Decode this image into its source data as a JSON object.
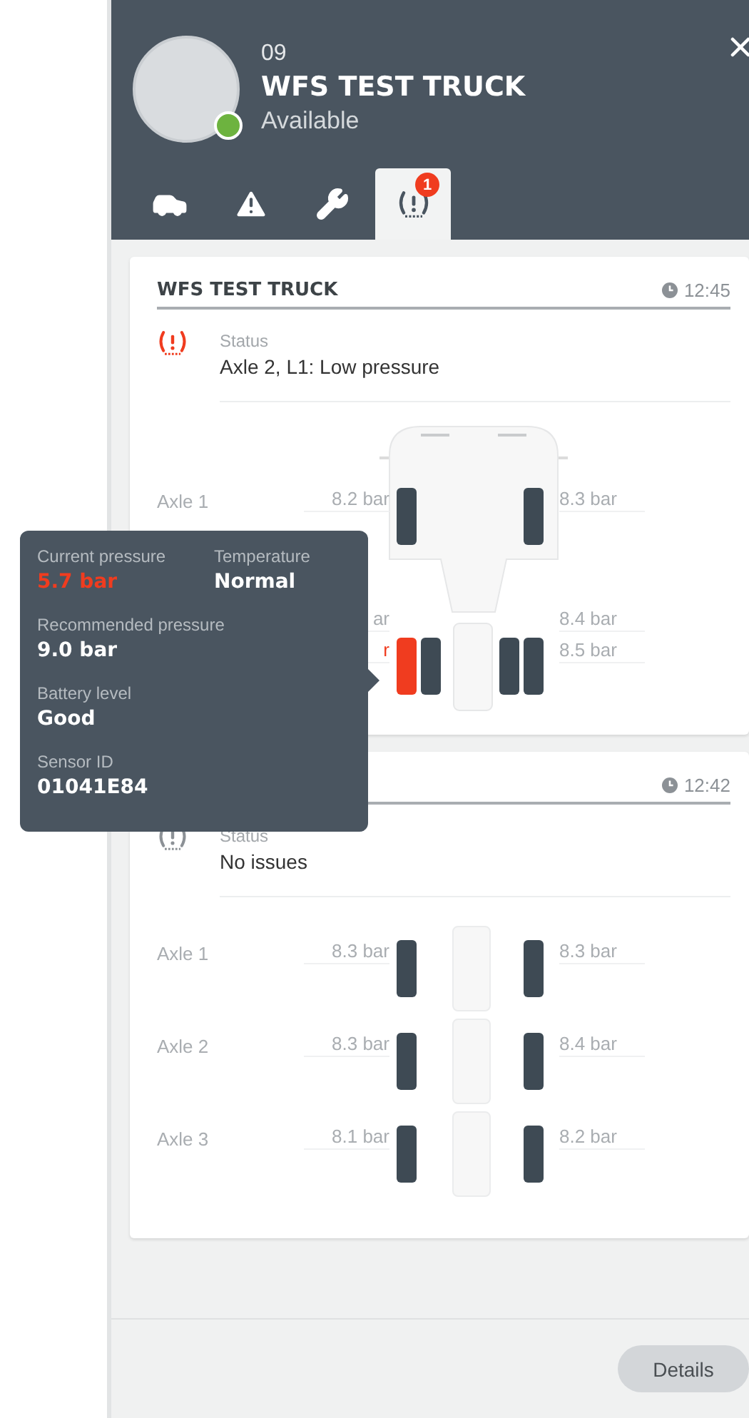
{
  "vehicle": {
    "number": "09",
    "name": "WFS TEST TRUCK",
    "status": "Available",
    "color": "#6db33f"
  },
  "tabs": [
    {
      "kind": "car",
      "selected": false
    },
    {
      "kind": "warning",
      "selected": false
    },
    {
      "kind": "wrench",
      "selected": false
    },
    {
      "kind": "tire",
      "selected": true,
      "badge": "1"
    }
  ],
  "cards": [
    {
      "title": "WFS TEST TRUCK",
      "time": "12:45",
      "status_label": "Status",
      "status": "Axle 2, L1: Low pressure",
      "alert": true,
      "kind": "outline",
      "axles": [
        {
          "label": "Axle 1",
          "left": {
            "readings": [
              {
                "text": "8.2 bar",
                "low": false
              }
            ],
            "tires": [
              {
                "low": false
              }
            ]
          },
          "right": {
            "readings": [
              {
                "text": "8.3 bar",
                "low": false
              }
            ],
            "tires": [
              {
                "low": false
              }
            ]
          }
        },
        {
          "left": {
            "readings": [
              {
                "text": "ar",
                "low": false
              },
              {
                "text": "r",
                "low": true
              }
            ],
            "tires": [
              {
                "low": true
              },
              {
                "low": false
              }
            ]
          },
          "right": {
            "readings": [
              {
                "text": "8.4 bar",
                "low": false
              },
              {
                "text": "8.5 bar",
                "low": false
              }
            ],
            "tires": [
              {
                "low": false
              },
              {
                "low": false
              }
            ]
          }
        }
      ]
    },
    {
      "time": "12:42",
      "status_label": "Status",
      "status": "No issues",
      "alert": false,
      "kind": "segments",
      "axles": [
        {
          "label": "Axle 1",
          "left": {
            "readings": [
              {
                "text": "8.3 bar",
                "low": false
              }
            ],
            "tires": [
              {
                "low": false
              }
            ]
          },
          "right": {
            "readings": [
              {
                "text": "8.3 bar",
                "low": false
              }
            ],
            "tires": [
              {
                "low": false
              }
            ]
          }
        },
        {
          "label": "Axle 2",
          "left": {
            "readings": [
              {
                "text": "8.3 bar",
                "low": false
              }
            ],
            "tires": [
              {
                "low": false
              }
            ]
          },
          "right": {
            "readings": [
              {
                "text": "8.4 bar",
                "low": false
              }
            ],
            "tires": [
              {
                "low": false
              }
            ]
          }
        },
        {
          "label": "Axle 3",
          "left": {
            "readings": [
              {
                "text": "8.1 bar",
                "low": false
              }
            ],
            "tires": [
              {
                "low": false
              }
            ]
          },
          "right": {
            "readings": [
              {
                "text": "8.2 bar",
                "low": false
              }
            ],
            "tires": [
              {
                "low": false
              }
            ]
          }
        }
      ]
    }
  ],
  "tooltip": {
    "rows": [
      [
        {
          "label": "Current pressure",
          "value": "5.7 bar",
          "alert": true
        },
        {
          "label": "Temperature",
          "value": "Normal",
          "alert": false
        }
      ],
      [
        {
          "label": "Recommended pressure",
          "value": "9.0 bar",
          "alert": false
        }
      ],
      [
        {
          "label": "Battery level",
          "value": "Good",
          "alert": false
        }
      ],
      [
        {
          "label": "Sensor ID",
          "value": "01041E84",
          "alert": false
        }
      ]
    ]
  },
  "details_button": "Details"
}
